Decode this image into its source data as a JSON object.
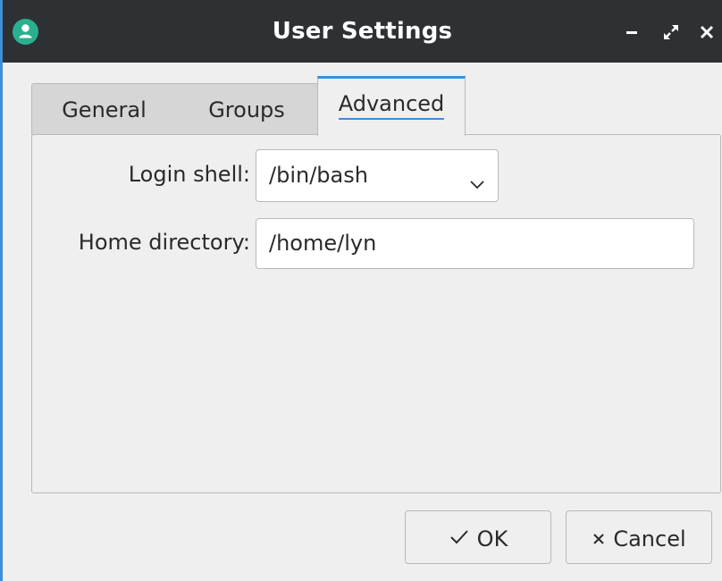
{
  "window": {
    "title": "User Settings",
    "app_icon": "user-icon",
    "controls": [
      "minimize-icon",
      "restore-icon",
      "close-icon"
    ],
    "accent": "#3d8fd6",
    "titlebar_color": "#2e3134"
  },
  "tabs": [
    {
      "label": "General",
      "active": false
    },
    {
      "label": "Groups",
      "active": false
    },
    {
      "label": "Advanced",
      "active": true
    }
  ],
  "form": {
    "login_shell_label": "Login shell:",
    "login_shell_value": "/bin/bash",
    "home_directory_label": "Home directory:",
    "home_directory_value": "/home/lyn"
  },
  "buttons": {
    "ok_label": "OK",
    "ok_icon": "checkmark-icon",
    "cancel_label": "Cancel",
    "cancel_icon": "x-icon"
  }
}
